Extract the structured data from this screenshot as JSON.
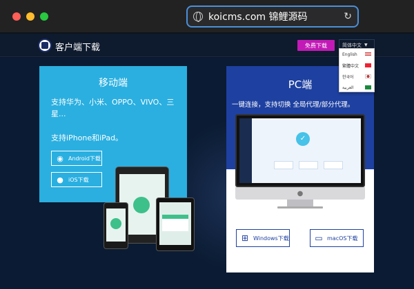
{
  "browser": {
    "url": "koicms.com 锦鲤源码"
  },
  "header": {
    "site_title": "客户端下载",
    "free_download": "免费下载",
    "language": "简体中文"
  },
  "language_menu": [
    {
      "label": "English",
      "flag": "us"
    },
    {
      "label": "繁體中文",
      "flag": "cn"
    },
    {
      "label": "한국어",
      "flag": "kr"
    },
    {
      "label": "العربية",
      "flag": "sa"
    }
  ],
  "mobile": {
    "title": "移动端",
    "desc": "支持华为、小米、OPPO、VIVO、三星...",
    "desc2": "支持iPhone和iPad。",
    "android_btn": "Android下载",
    "ios_btn": "iOS下载"
  },
  "pc": {
    "title": "PC端",
    "desc": "一键连接，支持切换 全局代理/部分代理。",
    "windows_btn": "Windows下载",
    "mac_btn": "macOS下载"
  },
  "colors": {
    "mobile_card": "#2aafe0",
    "pc_card": "#1e40a0",
    "free_btn": "#c21ab6"
  }
}
